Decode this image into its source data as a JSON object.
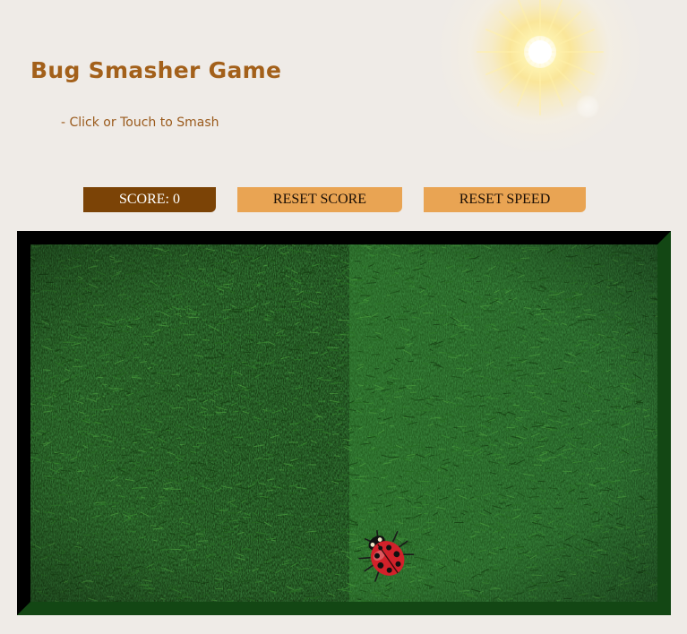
{
  "game": {
    "title": "Bug Smasher Game",
    "subtitle": "- Click or Touch to Smash"
  },
  "controls": {
    "score_label": "SCORE: 0",
    "score_value": 0,
    "reset_score_label": "RESET SCORE",
    "reset_speed_label": "RESET SPEED"
  },
  "colors": {
    "background": "#efebe7",
    "title_text": "#a3601a",
    "score_button": "#7b4306",
    "reset_buttons": "#e9a453",
    "frame_dark": "#000000",
    "frame_green": "#134714",
    "grass": "#1f4f1a",
    "ladybug_shell": "#d2212a"
  },
  "icons": {
    "sun": "sun-icon",
    "bug": "ladybug-icon"
  }
}
